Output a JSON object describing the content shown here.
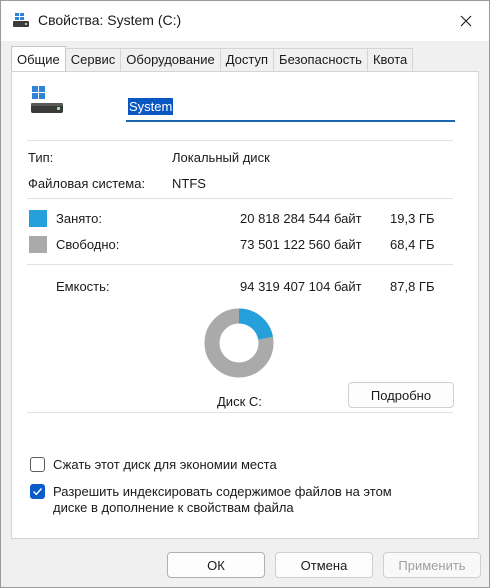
{
  "window": {
    "title": "Свойства: System (C:)"
  },
  "tabs": [
    {
      "label": "Общие",
      "active": true
    },
    {
      "label": "Сервис"
    },
    {
      "label": "Оборудование"
    },
    {
      "label": "Доступ"
    },
    {
      "label": "Безопасность"
    },
    {
      "label": "Квота"
    }
  ],
  "general": {
    "name_value": "System",
    "type_label": "Тип:",
    "type_value": "Локальный диск",
    "fs_label": "Файловая система:",
    "fs_value": "NTFS",
    "used_label": "Занято:",
    "used_bytes": "20 818 284 544 байт",
    "used_gb": "19,3 ГБ",
    "free_label": "Свободно:",
    "free_bytes": "73 501 122 560 байт",
    "free_gb": "68,4 ГБ",
    "capacity_label": "Емкость:",
    "capacity_bytes": "94 319 407 104 байт",
    "capacity_gb": "87,8 ГБ",
    "used_fraction": 0.2207,
    "disk_label": "Диск C:",
    "details_button": "Подробно",
    "compress_label": "Сжать этот диск для экономии места",
    "compress_checked": false,
    "index_label_line1": "Разрешить индексировать содержимое файлов на этом",
    "index_label_line2": "диске в дополнение к свойствам файла",
    "index_checked": true
  },
  "colors": {
    "used": "#26a0da",
    "free": "#aaaaaa",
    "accent": "#0b5cc9"
  },
  "footer": {
    "ok": "ОК",
    "cancel": "Отмена",
    "apply": "Применить"
  }
}
